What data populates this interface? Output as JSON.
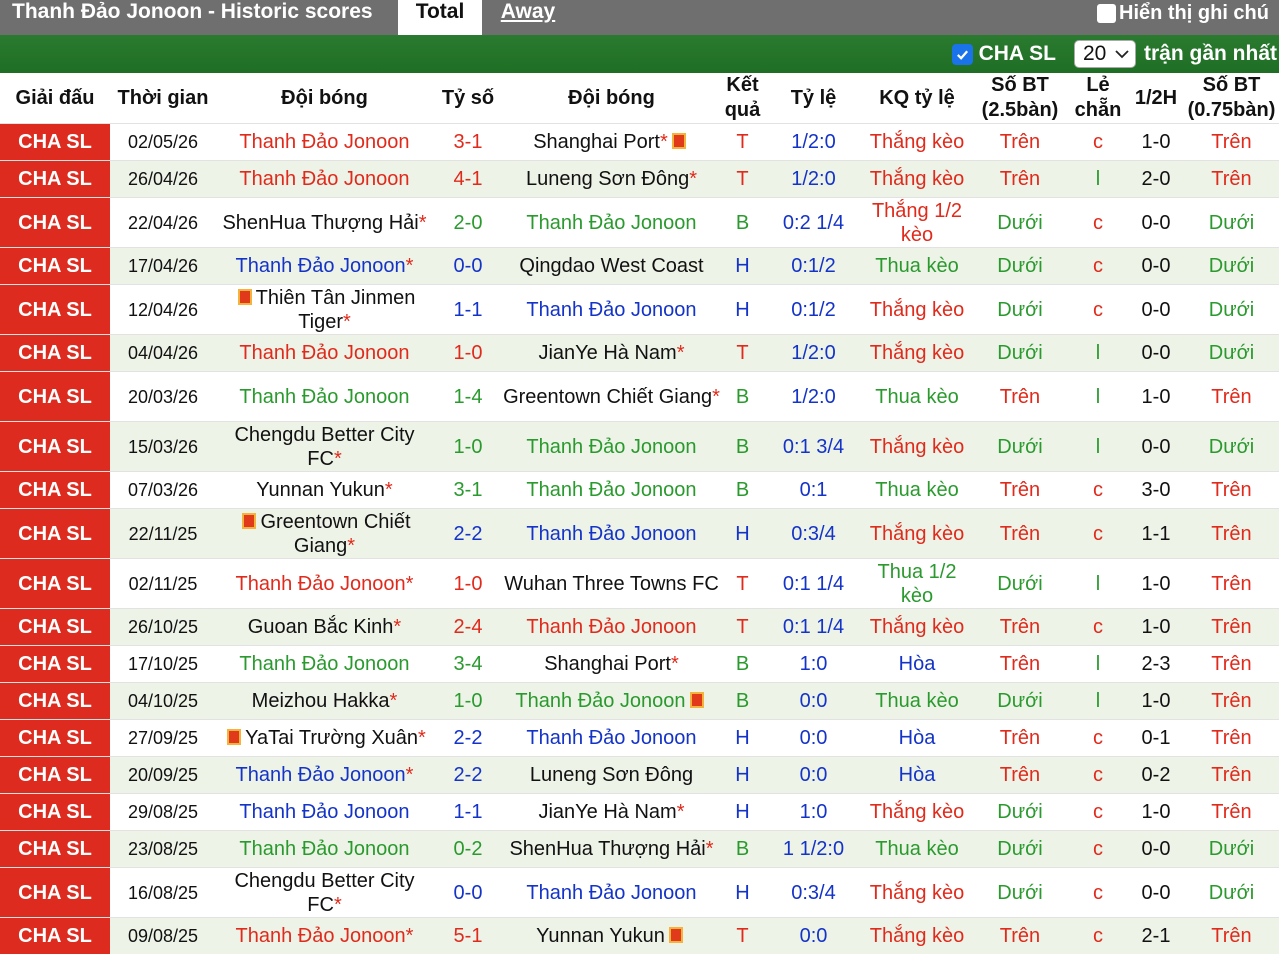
{
  "header": {
    "title": "Thanh Đảo Jonoon - Historic scores",
    "tabs": [
      {
        "label": "Total"
      },
      {
        "label": "Away"
      }
    ],
    "notes_label": "Hiển thị ghi chú"
  },
  "filter": {
    "league_label": "CHA SL",
    "count_value": "20",
    "recent_label": "trận gần nhất"
  },
  "columns": [
    "Giải đấu",
    "Thời gian",
    "Đội bóng",
    "Tỷ số",
    "Đội bóng",
    "Kết quả",
    "Tỷ lệ",
    "KQ tỷ lệ",
    "Số BT (2.5bàn)",
    "Lẻ chẵn",
    "1/2H",
    "Số BT (0.75bàn)"
  ],
  "colors": {
    "league_bg": "#dd2c1f",
    "win": "#e02a1b",
    "draw": "#1433c8",
    "loss": "#2a9a2e",
    "filter_bg": "#1f6e25"
  },
  "rows": [
    {
      "league": "CHA SL",
      "date": "02/05/26",
      "home": "Thanh Đảo Jonoon",
      "home_star": "",
      "home_flag": false,
      "home_color": "red",
      "score_h": "3",
      "score_a": "1",
      "away": "Shanghai Port",
      "away_star": "*",
      "away_flag": true,
      "away_color": "black",
      "result": "T",
      "odds": "1/2:0",
      "odds_result": "Thắng kèo",
      "ou": "Trên",
      "oe": "c",
      "half": "1-0",
      "ou2": "Trên"
    },
    {
      "league": "CHA SL",
      "date": "26/04/26",
      "home": "Thanh Đảo Jonoon",
      "home_star": "",
      "home_flag": false,
      "home_color": "red",
      "score_h": "4",
      "score_a": "1",
      "away": "Luneng Sơn Đông",
      "away_star": "*",
      "away_flag": false,
      "away_color": "black",
      "result": "T",
      "odds": "1/2:0",
      "odds_result": "Thắng kèo",
      "ou": "Trên",
      "oe": "l",
      "half": "2-0",
      "ou2": "Trên"
    },
    {
      "league": "CHA SL",
      "date": "22/04/26",
      "home": "ShenHua Thượng Hải",
      "home_star": "*",
      "home_flag": false,
      "home_color": "black",
      "score_h": "2",
      "score_a": "0",
      "away": "Thanh Đảo Jonoon",
      "away_star": "",
      "away_flag": false,
      "away_color": "green",
      "result": "B",
      "odds": "0:2 1/4",
      "odds_result": "Thắng 1/2 kèo",
      "ou": "Dưới",
      "oe": "c",
      "half": "0-0",
      "ou2": "Dưới"
    },
    {
      "league": "CHA SL",
      "date": "17/04/26",
      "home": "Thanh Đảo Jonoon",
      "home_star": "*",
      "home_flag": false,
      "home_color": "blue",
      "score_h": "0",
      "score_a": "0",
      "away": "Qingdao West Coast",
      "away_star": "",
      "away_flag": false,
      "away_color": "black",
      "result": "H",
      "odds": "0:1/2",
      "odds_result": "Thua kèo",
      "ou": "Dưới",
      "oe": "c",
      "half": "0-0",
      "ou2": "Dưới"
    },
    {
      "league": "CHA SL",
      "date": "12/04/26",
      "home": "Thiên Tân Jinmen Tiger",
      "home_star": "*",
      "home_flag": true,
      "home_color": "black",
      "score_h": "1",
      "score_a": "1",
      "away": "Thanh Đảo Jonoon",
      "away_star": "",
      "away_flag": false,
      "away_color": "blue",
      "result": "H",
      "odds": "0:1/2",
      "odds_result": "Thắng kèo",
      "ou": "Dưới",
      "oe": "c",
      "half": "0-0",
      "ou2": "Dưới"
    },
    {
      "league": "CHA SL",
      "date": "04/04/26",
      "home": "Thanh Đảo Jonoon",
      "home_star": "",
      "home_flag": false,
      "home_color": "red",
      "score_h": "1",
      "score_a": "0",
      "away": "JianYe Hà Nam",
      "away_star": "*",
      "away_flag": false,
      "away_color": "black",
      "result": "T",
      "odds": "1/2:0",
      "odds_result": "Thắng kèo",
      "ou": "Dưới",
      "oe": "l",
      "half": "0-0",
      "ou2": "Dưới"
    },
    {
      "league": "CHA SL",
      "date": "20/03/26",
      "home": "Thanh Đảo Jonoon",
      "home_star": "",
      "home_flag": false,
      "home_color": "green",
      "score_h": "1",
      "score_a": "4",
      "away": "Greentown Chiết Giang",
      "away_star": "*",
      "away_flag": false,
      "away_color": "black",
      "result": "B",
      "odds": "1/2:0",
      "odds_result": "Thua kèo",
      "ou": "Trên",
      "oe": "l",
      "half": "1-0",
      "ou2": "Trên"
    },
    {
      "league": "CHA SL",
      "date": "15/03/26",
      "home": "Chengdu Better City FC",
      "home_star": "*",
      "home_flag": false,
      "home_color": "black",
      "score_h": "1",
      "score_a": "0",
      "away": "Thanh Đảo Jonoon",
      "away_star": "",
      "away_flag": false,
      "away_color": "green",
      "result": "B",
      "odds": "0:1 3/4",
      "odds_result": "Thắng kèo",
      "ou": "Dưới",
      "oe": "l",
      "half": "0-0",
      "ou2": "Dưới"
    },
    {
      "league": "CHA SL",
      "date": "07/03/26",
      "home": "Yunnan Yukun",
      "home_star": "*",
      "home_flag": false,
      "home_color": "black",
      "score_h": "3",
      "score_a": "1",
      "away": "Thanh Đảo Jonoon",
      "away_star": "",
      "away_flag": false,
      "away_color": "green",
      "result": "B",
      "odds": "0:1",
      "odds_result": "Thua kèo",
      "ou": "Trên",
      "oe": "c",
      "half": "3-0",
      "ou2": "Trên"
    },
    {
      "league": "CHA SL",
      "date": "22/11/25",
      "home": "Greentown Chiết Giang",
      "home_star": "*",
      "home_flag": true,
      "home_color": "black",
      "score_h": "2",
      "score_a": "2",
      "away": "Thanh Đảo Jonoon",
      "away_star": "",
      "away_flag": false,
      "away_color": "blue",
      "result": "H",
      "odds": "0:3/4",
      "odds_result": "Thắng kèo",
      "ou": "Trên",
      "oe": "c",
      "half": "1-1",
      "ou2": "Trên"
    },
    {
      "league": "CHA SL",
      "date": "02/11/25",
      "home": "Thanh Đảo Jonoon",
      "home_star": "*",
      "home_flag": false,
      "home_color": "red",
      "score_h": "1",
      "score_a": "0",
      "away": "Wuhan Three Towns FC",
      "away_star": "",
      "away_flag": false,
      "away_color": "black",
      "result": "T",
      "odds": "0:1 1/4",
      "odds_result": "Thua 1/2 kèo",
      "ou": "Dưới",
      "oe": "l",
      "half": "1-0",
      "ou2": "Trên"
    },
    {
      "league": "CHA SL",
      "date": "26/10/25",
      "home": "Guoan Bắc Kinh",
      "home_star": "*",
      "home_flag": false,
      "home_color": "black",
      "score_h": "2",
      "score_a": "4",
      "away": "Thanh Đảo Jonoon",
      "away_star": "",
      "away_flag": false,
      "away_color": "red",
      "result": "T",
      "odds": "0:1 1/4",
      "odds_result": "Thắng kèo",
      "ou": "Trên",
      "oe": "c",
      "half": "1-0",
      "ou2": "Trên"
    },
    {
      "league": "CHA SL",
      "date": "17/10/25",
      "home": "Thanh Đảo Jonoon",
      "home_star": "",
      "home_flag": false,
      "home_color": "green",
      "score_h": "3",
      "score_a": "4",
      "away": "Shanghai Port",
      "away_star": "*",
      "away_flag": false,
      "away_color": "black",
      "result": "B",
      "odds": "1:0",
      "odds_result": "Hòa",
      "ou": "Trên",
      "oe": "l",
      "half": "2-3",
      "ou2": "Trên"
    },
    {
      "league": "CHA SL",
      "date": "04/10/25",
      "home": "Meizhou Hakka",
      "home_star": "*",
      "home_flag": false,
      "home_color": "black",
      "score_h": "1",
      "score_a": "0",
      "away": "Thanh Đảo Jonoon",
      "away_star": "",
      "away_flag": true,
      "away_color": "green",
      "result": "B",
      "odds": "0:0",
      "odds_result": "Thua kèo",
      "ou": "Dưới",
      "oe": "l",
      "half": "1-0",
      "ou2": "Trên"
    },
    {
      "league": "CHA SL",
      "date": "27/09/25",
      "home": "YaTai Trường Xuân",
      "home_star": "*",
      "home_flag": true,
      "home_color": "black",
      "score_h": "2",
      "score_a": "2",
      "away": "Thanh Đảo Jonoon",
      "away_star": "",
      "away_flag": false,
      "away_color": "blue",
      "result": "H",
      "odds": "0:0",
      "odds_result": "Hòa",
      "ou": "Trên",
      "oe": "c",
      "half": "0-1",
      "ou2": "Trên"
    },
    {
      "league": "CHA SL",
      "date": "20/09/25",
      "home": "Thanh Đảo Jonoon",
      "home_star": "*",
      "home_flag": false,
      "home_color": "blue",
      "score_h": "2",
      "score_a": "2",
      "away": "Luneng Sơn Đông",
      "away_star": "",
      "away_flag": false,
      "away_color": "black",
      "result": "H",
      "odds": "0:0",
      "odds_result": "Hòa",
      "ou": "Trên",
      "oe": "c",
      "half": "0-2",
      "ou2": "Trên"
    },
    {
      "league": "CHA SL",
      "date": "29/08/25",
      "home": "Thanh Đảo Jonoon",
      "home_star": "",
      "home_flag": false,
      "home_color": "blue",
      "score_h": "1",
      "score_a": "1",
      "away": "JianYe Hà Nam",
      "away_star": "*",
      "away_flag": false,
      "away_color": "black",
      "result": "H",
      "odds": "1:0",
      "odds_result": "Thắng kèo",
      "ou": "Dưới",
      "oe": "c",
      "half": "1-0",
      "ou2": "Trên"
    },
    {
      "league": "CHA SL",
      "date": "23/08/25",
      "home": "Thanh Đảo Jonoon",
      "home_star": "",
      "home_flag": false,
      "home_color": "green",
      "score_h": "0",
      "score_a": "2",
      "away": "ShenHua Thượng Hải",
      "away_star": "*",
      "away_flag": false,
      "away_color": "black",
      "result": "B",
      "odds": "1 1/2:0",
      "odds_result": "Thua kèo",
      "ou": "Dưới",
      "oe": "c",
      "half": "0-0",
      "ou2": "Dưới"
    },
    {
      "league": "CHA SL",
      "date": "16/08/25",
      "home": "Chengdu Better City FC",
      "home_star": "*",
      "home_flag": false,
      "home_color": "black",
      "score_h": "0",
      "score_a": "0",
      "away": "Thanh Đảo Jonoon",
      "away_star": "",
      "away_flag": false,
      "away_color": "blue",
      "result": "H",
      "odds": "0:3/4",
      "odds_result": "Thắng kèo",
      "ou": "Dưới",
      "oe": "c",
      "half": "0-0",
      "ou2": "Dưới"
    },
    {
      "league": "CHA SL",
      "date": "09/08/25",
      "home": "Thanh Đảo Jonoon",
      "home_star": "*",
      "home_flag": false,
      "home_color": "red",
      "score_h": "5",
      "score_a": "1",
      "away": "Yunnan Yukun",
      "away_star": "",
      "away_flag": true,
      "away_color": "black",
      "result": "T",
      "odds": "0:0",
      "odds_result": "Thắng kèo",
      "ou": "Trên",
      "oe": "c",
      "half": "2-1",
      "ou2": "Trên"
    }
  ]
}
